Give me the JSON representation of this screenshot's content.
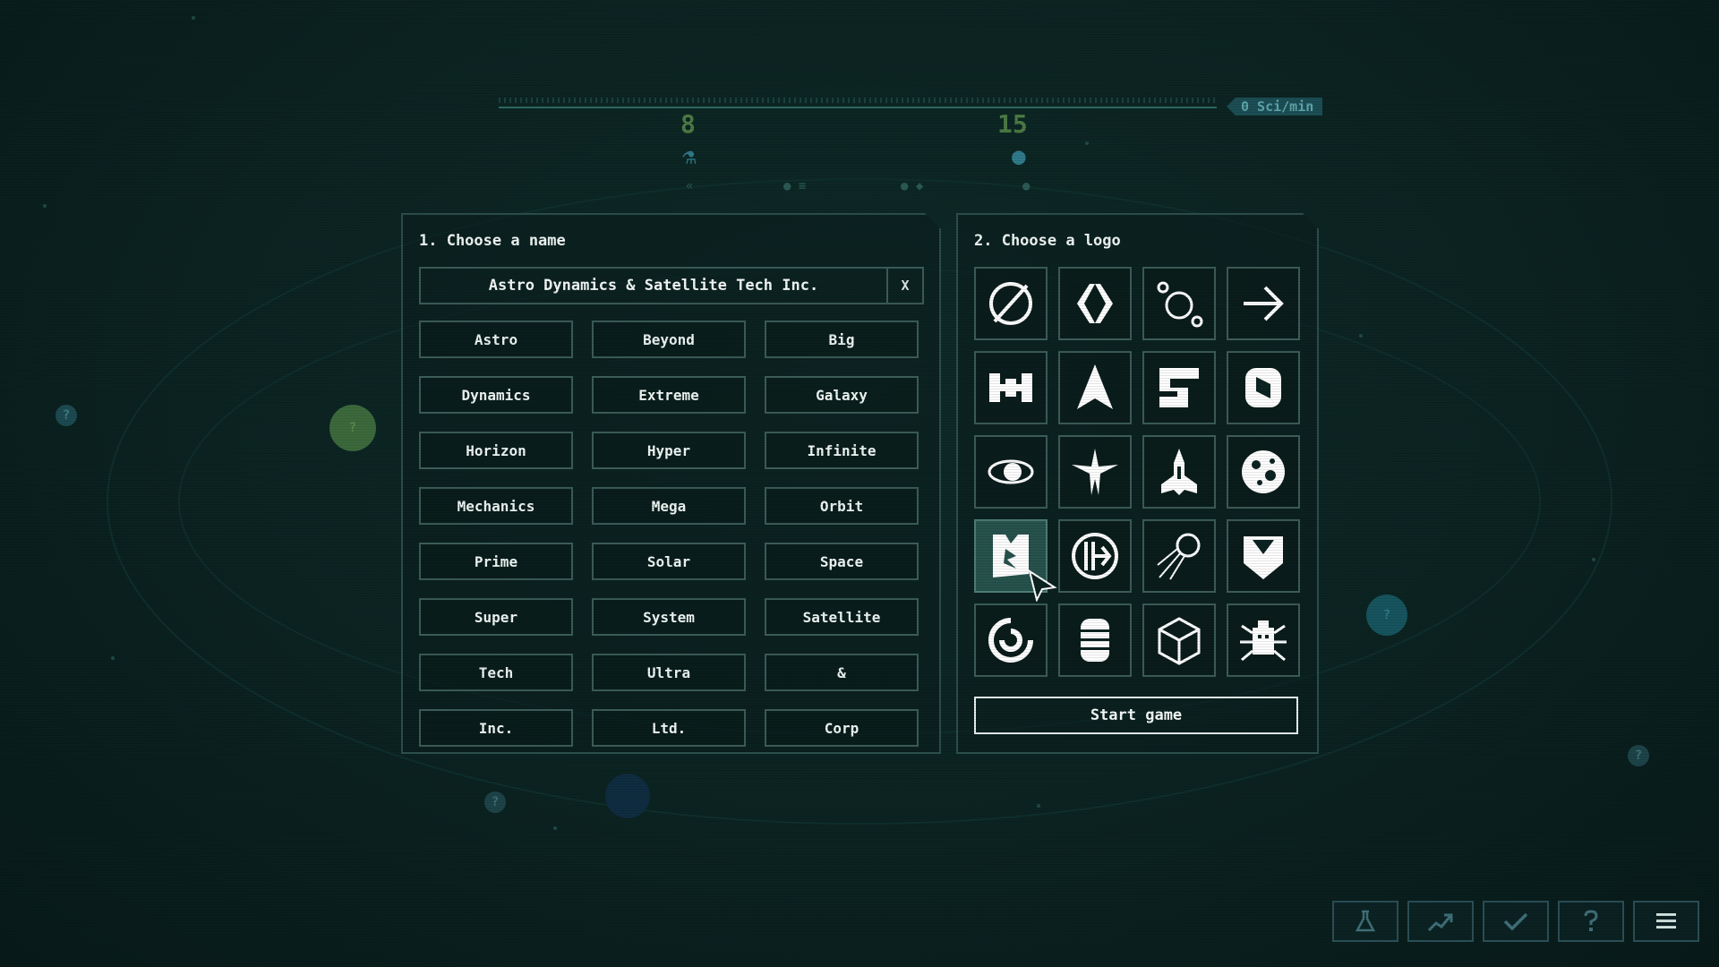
{
  "header": {
    "sci_rate": "0 Sci/min",
    "stat_left": "8",
    "stat_right": "15"
  },
  "name_panel": {
    "title": "1. Choose a name",
    "current_name": "Astro Dynamics & Satellite Tech Inc.",
    "clear_label": "X",
    "words": [
      "Astro",
      "Beyond",
      "Big",
      "Dynamics",
      "Extreme",
      "Galaxy",
      "Horizon",
      "Hyper",
      "Infinite",
      "Mechanics",
      "Mega",
      "Orbit",
      "Prime",
      "Solar",
      "Space",
      "Super",
      "System",
      "Satellite",
      "Tech",
      "Ultra",
      "&",
      "Inc.",
      "Ltd.",
      "Corp"
    ]
  },
  "logo_panel": {
    "title": "2. Choose a logo",
    "logos": [
      "null-sign",
      "diamond-brackets",
      "orbit-circles",
      "arrow-right",
      "satellite-h",
      "rocket-arrow",
      "square-spiral",
      "chain-link",
      "eye-orbit",
      "starburst-ship",
      "spaceship",
      "moon",
      "fox",
      "circle-arrow",
      "sputnik",
      "shield-x",
      "spiral",
      "barrel",
      "cube",
      "robot-beetle"
    ],
    "selected_logo": "fox",
    "start_label": "Start game"
  },
  "bottom_bar": {
    "buttons": [
      "flask-icon",
      "chart-up-icon",
      "check-icon",
      "question-icon",
      "menu-icon"
    ]
  },
  "markers": {
    "question": "?"
  },
  "colors": {
    "background": "#0b2321",
    "panel_border": "#2c4f4b",
    "accent_green": "#4c7a44",
    "accent_blue": "#2f7b8a"
  }
}
